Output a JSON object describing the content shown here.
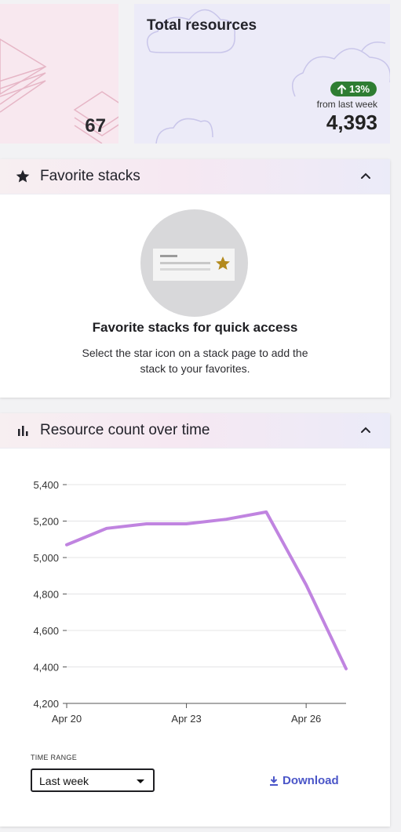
{
  "stat_cards": {
    "left_value": "67",
    "total": {
      "title": "Total resources",
      "trend": "13%",
      "trend_label": "from last week",
      "value": "4,393"
    }
  },
  "favorites": {
    "title": "Favorite stacks",
    "empty_title": "Favorite stacks for quick access",
    "empty_desc": "Select the star icon on a stack page to add the stack to your favorites."
  },
  "resource_chart": {
    "title": "Resource count over time",
    "time_range_label": "TIME RANGE",
    "time_range_value": "Last week",
    "download_label": "Download"
  },
  "colors": {
    "accent_line": "#c084e0",
    "trend_green": "#2e7d32",
    "link_blue": "#4a55c8",
    "star_gold": "#b38a1e"
  },
  "chart_data": {
    "type": "line",
    "x": [
      "Apr 20",
      "Apr 21",
      "Apr 22",
      "Apr 23",
      "Apr 24",
      "Apr 25",
      "Apr 26",
      "Apr 27"
    ],
    "values": [
      5070,
      5160,
      5185,
      5185,
      5210,
      5250,
      4850,
      4390
    ],
    "x_tick_labels": [
      "Apr 20",
      "Apr 23",
      "Apr 26"
    ],
    "y_ticks": [
      4200,
      4400,
      4600,
      4800,
      5000,
      5200,
      5400
    ],
    "y_tick_labels": [
      "4,200",
      "4,400",
      "4,600",
      "4,800",
      "5,000",
      "5,200",
      "5,400"
    ],
    "ylim": [
      4200,
      5400
    ],
    "grid": true
  }
}
